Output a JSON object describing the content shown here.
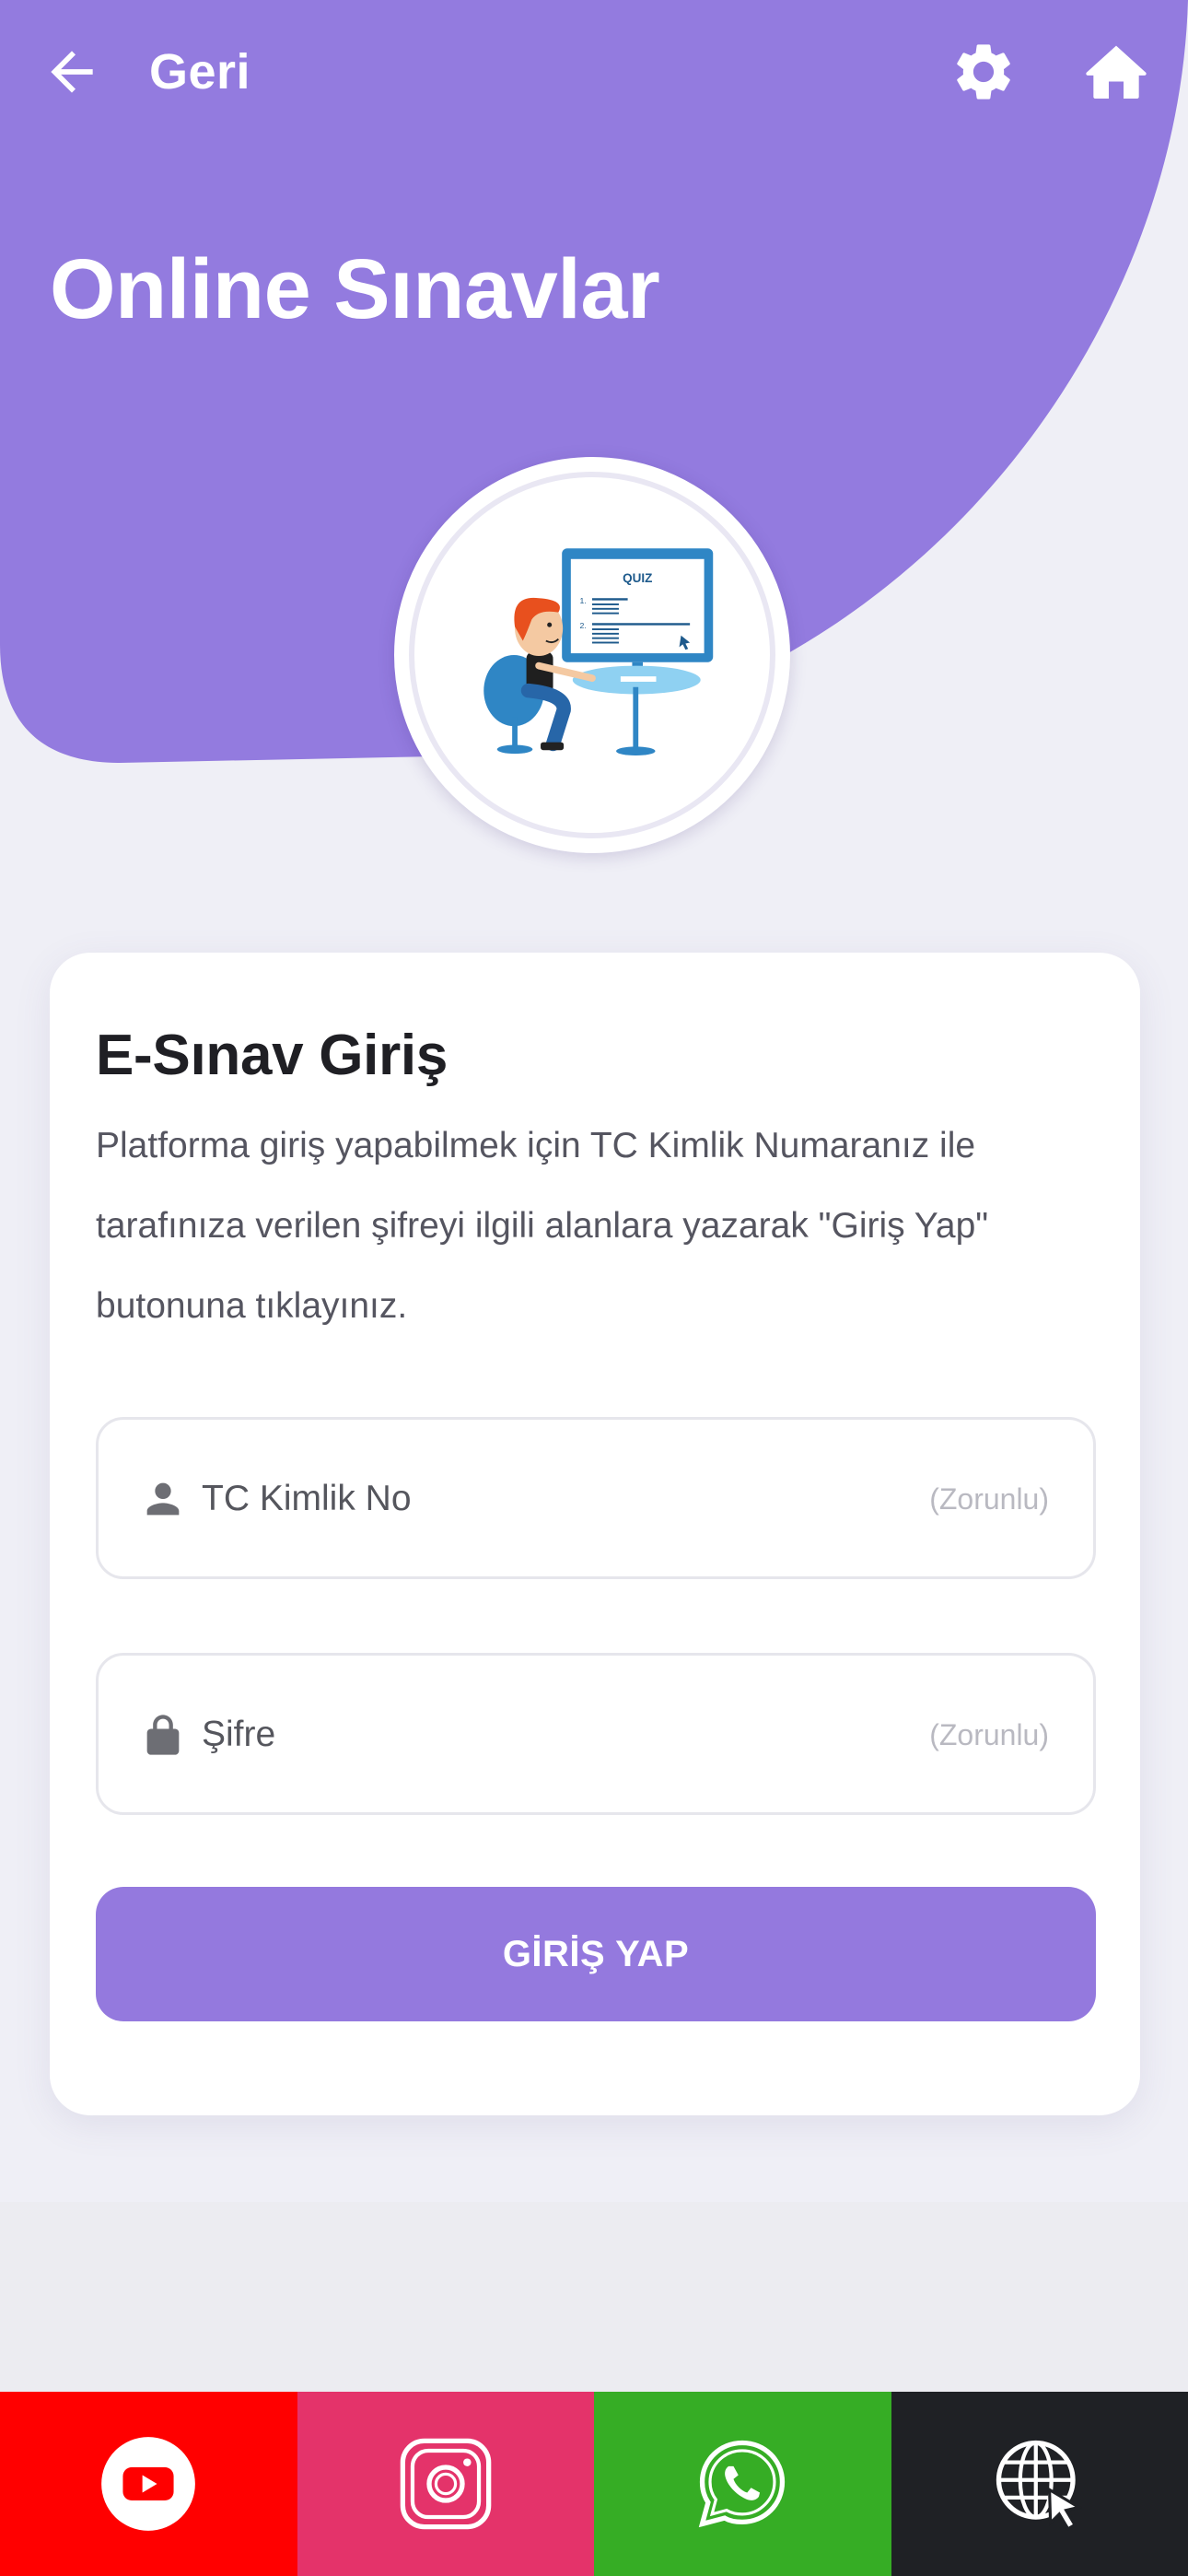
{
  "header": {
    "back_label": "Geri",
    "title": "Online Sınavlar",
    "settings_icon": "gear-icon",
    "home_icon": "home-icon",
    "accent_color": "#937bdf"
  },
  "illustration": {
    "screen_text": "QUIZ",
    "list_numbers": [
      "1.",
      "2."
    ]
  },
  "card": {
    "title": "E-Sınav Giriş",
    "description": "Platforma giriş yapabilmek için TC Kimlik Numaranız ile tarafınıza verilen şifreyi ilgili alanlara yazarak \"Giriş Yap\" butonuna tıklayınız.",
    "tc_field": {
      "placeholder": "TC Kimlik No",
      "hint": "(Zorunlu)",
      "icon": "user-icon"
    },
    "password_field": {
      "placeholder": "Şifre",
      "hint": "(Zorunlu)",
      "icon": "lock-icon"
    },
    "submit_label": "GİRİŞ YAP"
  },
  "social": [
    {
      "name": "youtube",
      "icon": "youtube-icon",
      "color": "#ff0000"
    },
    {
      "name": "instagram",
      "icon": "instagram-icon",
      "color": "#e4336a"
    },
    {
      "name": "whatsapp",
      "icon": "whatsapp-icon",
      "color": "#36ad25"
    },
    {
      "name": "web",
      "icon": "globe-cursor-icon",
      "color": "#1f2125"
    }
  ]
}
